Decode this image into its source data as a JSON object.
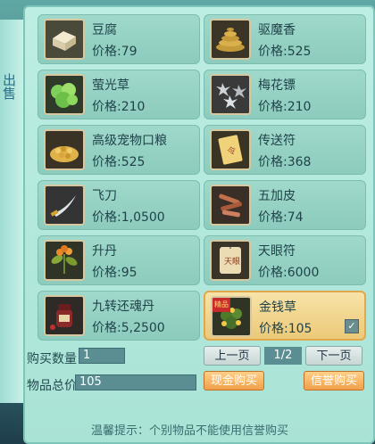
{
  "side_tab": {
    "label": "出售"
  },
  "items": [
    {
      "name": "豆腐",
      "price": "价格:79",
      "icon": "tofu-icon",
      "selected": false
    },
    {
      "name": "驱魔香",
      "price": "价格:525",
      "icon": "incense-coil-icon",
      "selected": false
    },
    {
      "name": "萤光草",
      "price": "价格:210",
      "icon": "glowing-herb-icon",
      "selected": false
    },
    {
      "name": "梅花镖",
      "price": "价格:210",
      "icon": "shuriken-icon",
      "selected": false
    },
    {
      "name": "高级宠物口粮",
      "price": "价格:525",
      "icon": "pet-food-icon",
      "selected": false
    },
    {
      "name": "传送符",
      "price": "价格:368",
      "icon": "teleport-scroll-icon",
      "selected": false
    },
    {
      "name": "飞刀",
      "price": "价格:1,0500",
      "icon": "flying-knife-icon",
      "selected": false
    },
    {
      "name": "五加皮",
      "price": "价格:74",
      "icon": "bark-herb-icon",
      "selected": false
    },
    {
      "name": "升丹",
      "price": "价格:95",
      "icon": "elixir-herb-icon",
      "selected": false
    },
    {
      "name": "天眼符",
      "price": "价格:6000",
      "icon": "eye-talisman-icon",
      "selected": false
    },
    {
      "name": "九转还魂丹",
      "price": "价格:5,2500",
      "icon": "pill-jar-icon",
      "selected": false
    },
    {
      "name": "金钱草",
      "price": "价格:105",
      "icon": "money-grass-icon",
      "selected": true,
      "badge": "精品"
    }
  ],
  "purchase": {
    "quantity_label": "购买数量",
    "quantity_value": "1",
    "total_label": "物品总价",
    "total_value": "105"
  },
  "pagination": {
    "prev": "上一页",
    "indicator": "1/2",
    "next": "下一页"
  },
  "buttons": {
    "cash_buy": "现金购买",
    "credit_buy": "信誉购买"
  },
  "tip": "温馨提示：个别物品不能使用信誉购买",
  "colors": {
    "panel": "#b5eadf",
    "selected": "#f2d58f",
    "accent_orange": "#f0a048"
  }
}
